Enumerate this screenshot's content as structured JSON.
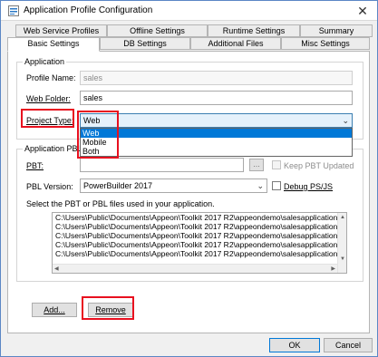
{
  "window": {
    "title": "Application Profile Configuration"
  },
  "tabs": {
    "row1": [
      "Web Service Profiles",
      "Offline Settings",
      "Runtime Settings",
      "Summary"
    ],
    "row2": [
      "Basic Settings",
      "DB Settings",
      "Additional Files",
      "Misc Settings"
    ]
  },
  "application": {
    "group_label": "Application",
    "profile_name_label": "Profile Name:",
    "profile_name_value": "sales",
    "web_folder_label": "Web Folder:",
    "web_folder_value": "sales",
    "project_type_label": "Project Type:",
    "project_type_value": "Web",
    "project_type_options": [
      "Web",
      "Mobile",
      "Both"
    ]
  },
  "pbls": {
    "group_label": "Application PBLs",
    "pbt_label": "PBT:",
    "pbt_value": "",
    "browse_label": "...",
    "keep_pbt_label": "Keep PBT Updated",
    "pbl_version_label": "PBL Version:",
    "pbl_version_value": "PowerBuilder 2017",
    "debug_label": "Debug PS/JS",
    "instruction": "Select the PBT or PBL files used in your application.",
    "files": [
      "C:\\Users\\Public\\Documents\\Appeon\\Toolkit 2017 R2\\appeondemo\\salesapplicationdemo\\sales",
      "C:\\Users\\Public\\Documents\\Appeon\\Toolkit 2017 R2\\appeondemo\\salesapplicationdemo\\sales",
      "C:\\Users\\Public\\Documents\\Appeon\\Toolkit 2017 R2\\appeondemo\\salesapplicationdemo\\sales",
      "C:\\Users\\Public\\Documents\\Appeon\\Toolkit 2017 R2\\appeondemo\\salesapplicationdemo\\appe",
      "C:\\Users\\Public\\Documents\\Appeon\\Toolkit 2017 R2\\appeondemo\\salesapplicationdemo\\appe"
    ],
    "add_label": "Add...",
    "remove_label": "Remove"
  },
  "footer": {
    "ok_label": "OK",
    "cancel_label": "Cancel"
  },
  "colors": {
    "highlight": "#e8101f",
    "selection": "#0078d7",
    "focus": "#3c7fb1"
  }
}
